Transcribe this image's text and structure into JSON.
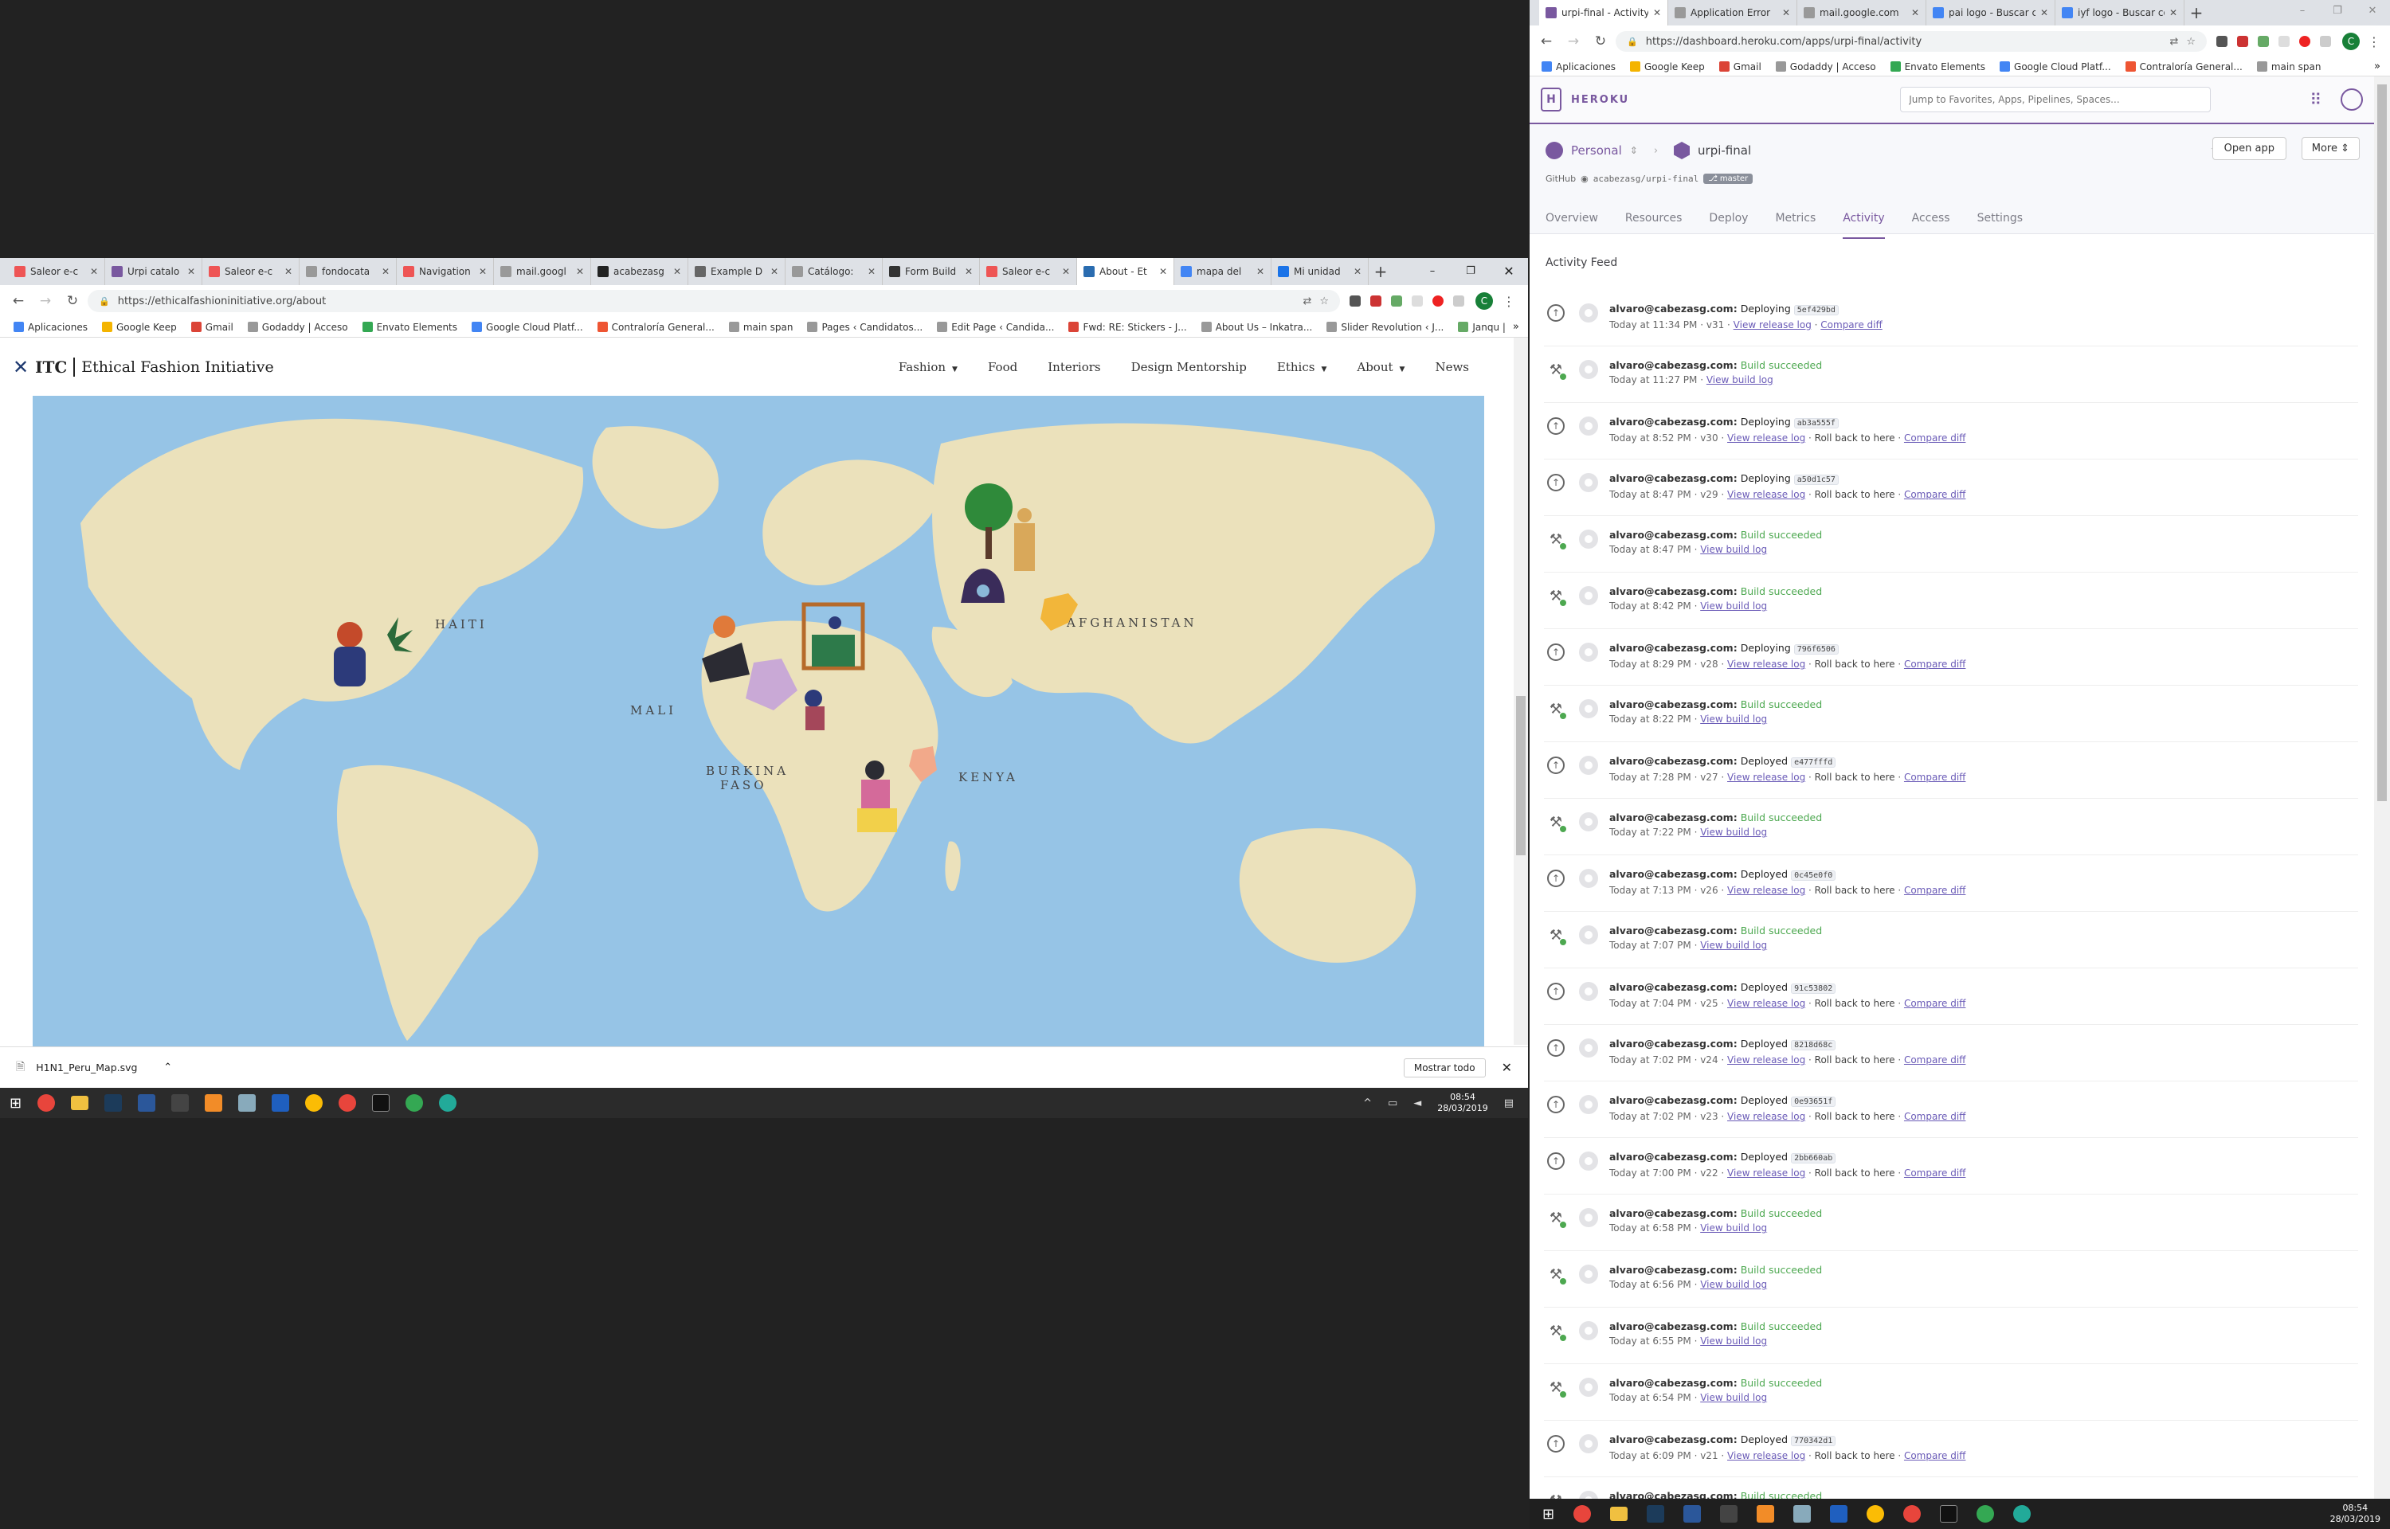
{
  "left_window": {
    "tabs": [
      {
        "label": "Saleor e-c",
        "color": "#e55"
      },
      {
        "label": "Urpi catalo",
        "color": "#79589f"
      },
      {
        "label": "Saleor e-c",
        "color": "#e55"
      },
      {
        "label": "fondocata",
        "color": "#999"
      },
      {
        "label": "Navigation",
        "color": "#e55"
      },
      {
        "label": "mail.googl",
        "color": "#999"
      },
      {
        "label": "acabezasg",
        "color": "#222"
      },
      {
        "label": "Example D",
        "color": "#666"
      },
      {
        "label": "Catálogo:",
        "color": "#999"
      },
      {
        "label": "Form Build",
        "color": "#333"
      },
      {
        "label": "Saleor e-c",
        "color": "#e55"
      },
      {
        "label": "About - Et",
        "color": "#2a6cb0",
        "active": true
      },
      {
        "label": "mapa del",
        "color": "#4285f4"
      },
      {
        "label": "Mi unidad",
        "color": "#1a73e8"
      }
    ],
    "url": "https://ethicalfashioninitiative.org/about",
    "bookmarks": [
      "Aplicaciones",
      "Google Keep",
      "Gmail",
      "Godaddy | Acceso",
      "Envato Elements",
      "Google Cloud Platf...",
      "Contraloría General...",
      "main span",
      "Pages ‹ Candidatos...",
      "Edit Page ‹ Candida...",
      "Fwd: RE: Stickers - J...",
      "About Us – Inkatra...",
      "Slider Revolution ‹ J...",
      "Janqu |"
    ],
    "site": {
      "logo_itc": "ITC",
      "logo_text": "Ethical Fashion Initiative",
      "nav": [
        "Fashion",
        "Food",
        "Interiors",
        "Design Mentorship",
        "Ethics",
        "About",
        "News"
      ],
      "map_labels": [
        "HAITI",
        "MALI",
        "BURKINA",
        "FASO",
        "AFGHANISTAN",
        "KENYA"
      ]
    },
    "download": {
      "file": "H1N1_Peru_Map.svg",
      "show_all": "Mostrar todo"
    }
  },
  "taskbar_small": {
    "time": "08:54",
    "date": "28/03/2019"
  },
  "right_window": {
    "tabs": [
      {
        "label": "urpi-final - Activity",
        "color": "#79589f",
        "active": true
      },
      {
        "label": "Application Error",
        "color": "#999"
      },
      {
        "label": "mail.google.com",
        "color": "#999"
      },
      {
        "label": "pai logo - Buscar co",
        "color": "#4285f4"
      },
      {
        "label": "iyf logo - Buscar co",
        "color": "#4285f4"
      }
    ],
    "url": "https://dashboard.heroku.com/apps/urpi-final/activity",
    "bookmarks": [
      "Aplicaciones",
      "Google Keep",
      "Gmail",
      "Godaddy | Acceso",
      "Envato Elements",
      "Google Cloud Platf...",
      "Contraloría General...",
      "main span"
    ],
    "heroku": {
      "brand": "HEROKU",
      "search_placeholder": "Jump to Favorites, Apps, Pipelines, Spaces...",
      "account": "Personal",
      "app": "urpi-final",
      "github_label": "GitHub",
      "repo": "acabezasg/urpi-final",
      "branch": "master",
      "open_app": "Open app",
      "more": "More",
      "tabs": [
        "Overview",
        "Resources",
        "Deploy",
        "Metrics",
        "Activity",
        "Access",
        "Settings"
      ],
      "active_tab": "Activity",
      "feed_title": "Activity Feed",
      "feed": [
        {
          "kind": "deploy",
          "user": "alvaro@cabezasg.com:",
          "action": "Deploying",
          "hash": "5ef429bd",
          "time": "Today at 11:34 PM",
          "ver": "v31",
          "l1": "View release log",
          "rb": "",
          "l2": "Compare diff"
        },
        {
          "kind": "build",
          "user": "alvaro@cabezasg.com:",
          "action": "Build succeeded",
          "time": "Today at 11:27 PM",
          "l1": "View build log"
        },
        {
          "kind": "deploy",
          "user": "alvaro@cabezasg.com:",
          "action": "Deploying",
          "hash": "ab3a555f",
          "time": "Today at 8:52 PM",
          "ver": "v30",
          "l1": "View release log",
          "rb": "Roll back to here",
          "l2": "Compare diff"
        },
        {
          "kind": "deploy",
          "user": "alvaro@cabezasg.com:",
          "action": "Deploying",
          "hash": "a50d1c57",
          "time": "Today at 8:47 PM",
          "ver": "v29",
          "l1": "View release log",
          "rb": "Roll back to here",
          "l2": "Compare diff"
        },
        {
          "kind": "build",
          "user": "alvaro@cabezasg.com:",
          "action": "Build succeeded",
          "time": "Today at 8:47 PM",
          "l1": "View build log"
        },
        {
          "kind": "build",
          "user": "alvaro@cabezasg.com:",
          "action": "Build succeeded",
          "time": "Today at 8:42 PM",
          "l1": "View build log"
        },
        {
          "kind": "deploy",
          "user": "alvaro@cabezasg.com:",
          "action": "Deploying",
          "hash": "796f6506",
          "time": "Today at 8:29 PM",
          "ver": "v28",
          "l1": "View release log",
          "rb": "Roll back to here",
          "l2": "Compare diff"
        },
        {
          "kind": "build",
          "user": "alvaro@cabezasg.com:",
          "action": "Build succeeded",
          "time": "Today at 8:22 PM",
          "l1": "View build log"
        },
        {
          "kind": "deploy",
          "user": "alvaro@cabezasg.com:",
          "action": "Deployed",
          "hash": "e477fffd",
          "time": "Today at 7:28 PM",
          "ver": "v27",
          "l1": "View release log",
          "rb": "Roll back to here",
          "l2": "Compare diff"
        },
        {
          "kind": "build",
          "user": "alvaro@cabezasg.com:",
          "action": "Build succeeded",
          "time": "Today at 7:22 PM",
          "l1": "View build log"
        },
        {
          "kind": "deploy",
          "user": "alvaro@cabezasg.com:",
          "action": "Deployed",
          "hash": "0c45e0f0",
          "time": "Today at 7:13 PM",
          "ver": "v26",
          "l1": "View release log",
          "rb": "Roll back to here",
          "l2": "Compare diff"
        },
        {
          "kind": "build",
          "user": "alvaro@cabezasg.com:",
          "action": "Build succeeded",
          "time": "Today at 7:07 PM",
          "l1": "View build log"
        },
        {
          "kind": "deploy",
          "user": "alvaro@cabezasg.com:",
          "action": "Deployed",
          "hash": "91c53802",
          "time": "Today at 7:04 PM",
          "ver": "v25",
          "l1": "View release log",
          "rb": "Roll back to here",
          "l2": "Compare diff"
        },
        {
          "kind": "deploy",
          "user": "alvaro@cabezasg.com:",
          "action": "Deployed",
          "hash": "8218d68c",
          "time": "Today at 7:02 PM",
          "ver": "v24",
          "l1": "View release log",
          "rb": "Roll back to here",
          "l2": "Compare diff"
        },
        {
          "kind": "deploy",
          "user": "alvaro@cabezasg.com:",
          "action": "Deployed",
          "hash": "0e93651f",
          "time": "Today at 7:02 PM",
          "ver": "v23",
          "l1": "View release log",
          "rb": "Roll back to here",
          "l2": "Compare diff"
        },
        {
          "kind": "deploy",
          "user": "alvaro@cabezasg.com:",
          "action": "Deployed",
          "hash": "2bb660ab",
          "time": "Today at 7:00 PM",
          "ver": "v22",
          "l1": "View release log",
          "rb": "Roll back to here",
          "l2": "Compare diff"
        },
        {
          "kind": "build",
          "user": "alvaro@cabezasg.com:",
          "action": "Build succeeded",
          "time": "Today at 6:58 PM",
          "l1": "View build log"
        },
        {
          "kind": "build",
          "user": "alvaro@cabezasg.com:",
          "action": "Build succeeded",
          "time": "Today at 6:56 PM",
          "l1": "View build log"
        },
        {
          "kind": "build",
          "user": "alvaro@cabezasg.com:",
          "action": "Build succeeded",
          "time": "Today at 6:55 PM",
          "l1": "View build log"
        },
        {
          "kind": "build",
          "user": "alvaro@cabezasg.com:",
          "action": "Build succeeded",
          "time": "Today at 6:54 PM",
          "l1": "View build log"
        },
        {
          "kind": "deploy",
          "user": "alvaro@cabezasg.com:",
          "action": "Deployed",
          "hash": "770342d1",
          "time": "Today at 6:09 PM",
          "ver": "v21",
          "l1": "View release log",
          "rb": "Roll back to here",
          "l2": "Compare diff"
        },
        {
          "kind": "build",
          "user": "alvaro@cabezasg.com:",
          "action": "Build succeeded",
          "time": "",
          "l1": ""
        }
      ]
    }
  },
  "taskbar": {
    "time": "08:54",
    "date": "28/03/2019"
  }
}
